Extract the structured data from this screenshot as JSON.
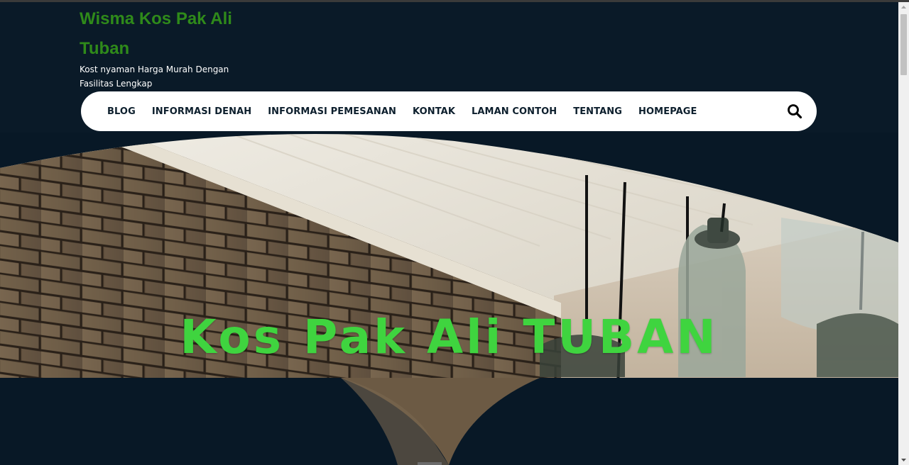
{
  "site": {
    "title": "Wisma Kos Pak Ali Tuban",
    "description": "Kost nyaman Harga Murah Dengan Fasilitas Lengkap"
  },
  "nav": {
    "items": [
      {
        "label": "BLOG"
      },
      {
        "label": "INFORMASI DENAH"
      },
      {
        "label": "INFORMASI PEMESANAN"
      },
      {
        "label": "KONTAK"
      },
      {
        "label": "LAMAN CONTOH"
      },
      {
        "label": "TENTANG"
      },
      {
        "label": "HOMEPAGE"
      }
    ],
    "search_icon": "search-icon"
  },
  "hero": {
    "title": "Kos Pak Ali TUBAN"
  },
  "colors": {
    "page_bg": "#081826",
    "header_bg": "#0a1a28",
    "title_green": "#2f8a1a",
    "hero_text_green": "#3fd43f",
    "nav_bg": "#ffffff",
    "nav_text": "#0d1f2d"
  }
}
